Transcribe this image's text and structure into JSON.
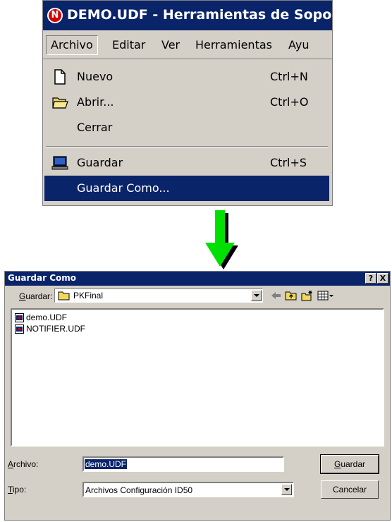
{
  "app_window": {
    "title": "DEMO.UDF - Herramientas de Sopor",
    "logo_letter": "N",
    "menubar": [
      "Archivo",
      "Editar",
      "Ver",
      "Herramientas",
      "Ayu"
    ],
    "file_menu": [
      {
        "label": "Nuevo",
        "shortcut": "Ctrl+N",
        "icon": "new-document-icon"
      },
      {
        "label": "Abrir...",
        "shortcut": "Ctrl+O",
        "icon": "open-folder-icon"
      },
      {
        "label": "Cerrar",
        "shortcut": "",
        "icon": ""
      },
      {
        "label": "Guardar",
        "shortcut": "Ctrl+S",
        "icon": "save-computer-icon"
      },
      {
        "label": "Guardar Como...",
        "shortcut": "",
        "icon": "",
        "highlighted": true
      }
    ]
  },
  "arrow": {
    "color": "#00e000",
    "direction": "down"
  },
  "dialog": {
    "title": "Guardar Como",
    "help_button": "?",
    "close_button": "X",
    "save_in_label_prefix": "G",
    "save_in_label_rest": "uardar:",
    "save_in_value": "PKFinal",
    "files": [
      "demo.UDF",
      "NOTIFIER.UDF"
    ],
    "filename_label_prefix": "A",
    "filename_label_rest": "rchivo:",
    "filename_value": "demo.UDF",
    "filetype_label_prefix": "T",
    "filetype_label_rest": "ipo:",
    "filetype_value": "Archivos Configuración ID50",
    "save_button_prefix": "G",
    "save_button_rest": "uardar",
    "cancel_button": "Cancelar"
  },
  "colors": {
    "titlebar": "#0a246a",
    "face": "#d4d0c8",
    "highlight": "#0a246a"
  }
}
